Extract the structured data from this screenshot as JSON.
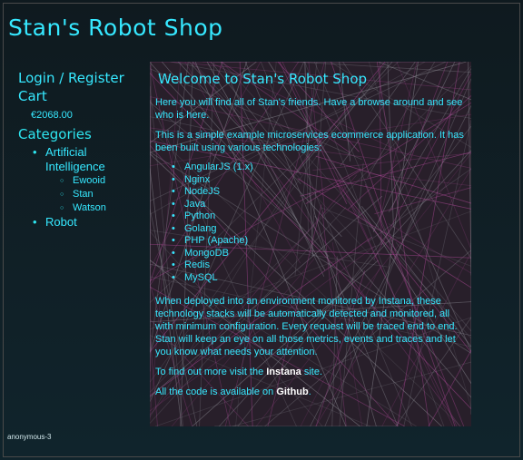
{
  "header": {
    "title": "Stan's Robot Shop"
  },
  "sidebar": {
    "login_label": "Login / Register",
    "cart_label": "Cart",
    "cart_total": "€2068.00",
    "categories_label": "Categories",
    "categories": [
      {
        "label": "Artificial Intelligence",
        "items": [
          "Ewooid",
          "Stan",
          "Watson"
        ]
      },
      {
        "label": "Robot",
        "items": []
      }
    ]
  },
  "main": {
    "heading": "Welcome to Stan's Robot Shop",
    "intro": "Here you will find all of Stan's friends. Have a browse around and see who is here.",
    "tech_intro": "This is a simple example microservices ecommerce application. It has been built using various technologies:",
    "technologies": [
      "AngularJS (1.x)",
      "Nginx",
      "NodeJS",
      "Java",
      "Python",
      "Golang",
      "PHP (Apache)",
      "MongoDB",
      "Redis",
      "MySQL"
    ],
    "monitoring": "When deployed into an environment monitored by Instana, these technology stacks will be automatically detected and monitored, all with minimum configuration. Every request will be traced end to end. Stan will keep an eye on all those metrics, events and traces and let you know what needs your attention.",
    "more_prefix": "To find out more visit the ",
    "more_link": "Instana",
    "more_suffix": " site.",
    "code_prefix": "All the code is available on ",
    "code_link": "Github",
    "code_suffix": "."
  },
  "footer": {
    "user": "anonymous-3"
  },
  "colors": {
    "accent": "#36e8ff",
    "panel": "#281f2a",
    "background": "#10242c"
  }
}
